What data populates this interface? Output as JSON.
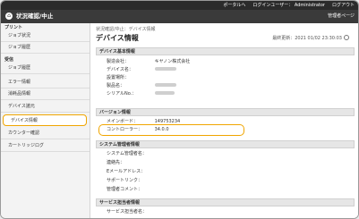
{
  "topbar": {
    "portal_link": "ポータルへ",
    "login_user_label": "ログインユーザー：",
    "login_user": "Administrator",
    "logout": "ログアウト"
  },
  "header": {
    "title": "状況確認/中止",
    "management_link": "管理者ページ"
  },
  "sidebar": {
    "sections": [
      {
        "title": "プリント",
        "items": [
          "ジョブ状況",
          "ジョブ履歴"
        ]
      },
      {
        "title": "受信",
        "items": [
          "ジョブ履歴"
        ]
      }
    ],
    "items_other": [
      "エラー情報",
      "消耗品情報",
      "デバイス諸元",
      "デバイス情報",
      "カウンター確認",
      "カートリッジログ"
    ],
    "active_item": "デバイス情報"
  },
  "main": {
    "breadcrumb": "状況確認/中止：デバイス情報",
    "page_title": "デバイス情報",
    "updated": "最終更新：2021 01/02 23:30:03",
    "sections": [
      {
        "title": "デバイス基本情報",
        "rows": [
          {
            "label": "製造会社：",
            "value": "キヤノン株式会社"
          },
          {
            "label": "デバイス名：",
            "value": ""
          },
          {
            "label": "設置場所：",
            "value": ""
          },
          {
            "label": "製品名：",
            "value": ""
          },
          {
            "label": "シリアルNo.：",
            "value": ""
          }
        ]
      },
      {
        "title": "バージョン情報",
        "rows": [
          {
            "label": "メインボード：",
            "value": "149753234"
          },
          {
            "label": "コントローラー：",
            "value": "34.0.0"
          }
        ]
      },
      {
        "title": "システム管理者情報",
        "rows": [
          {
            "label": "システム管理者名：",
            "value": ""
          },
          {
            "label": "連絡先：",
            "value": ""
          },
          {
            "label": "Eメールアドレス：",
            "value": ""
          },
          {
            "label": "サポートリンク：",
            "value": ""
          },
          {
            "label": "管理者コメント：",
            "value": ""
          }
        ]
      },
      {
        "title": "サービス担当者情報",
        "rows": [
          {
            "label": "サービス担当者名：",
            "value": ""
          }
        ]
      }
    ]
  },
  "colors": {
    "header": "#3a3a3a",
    "topbar": "#2b2b2b",
    "highlight": "#f0a500"
  }
}
